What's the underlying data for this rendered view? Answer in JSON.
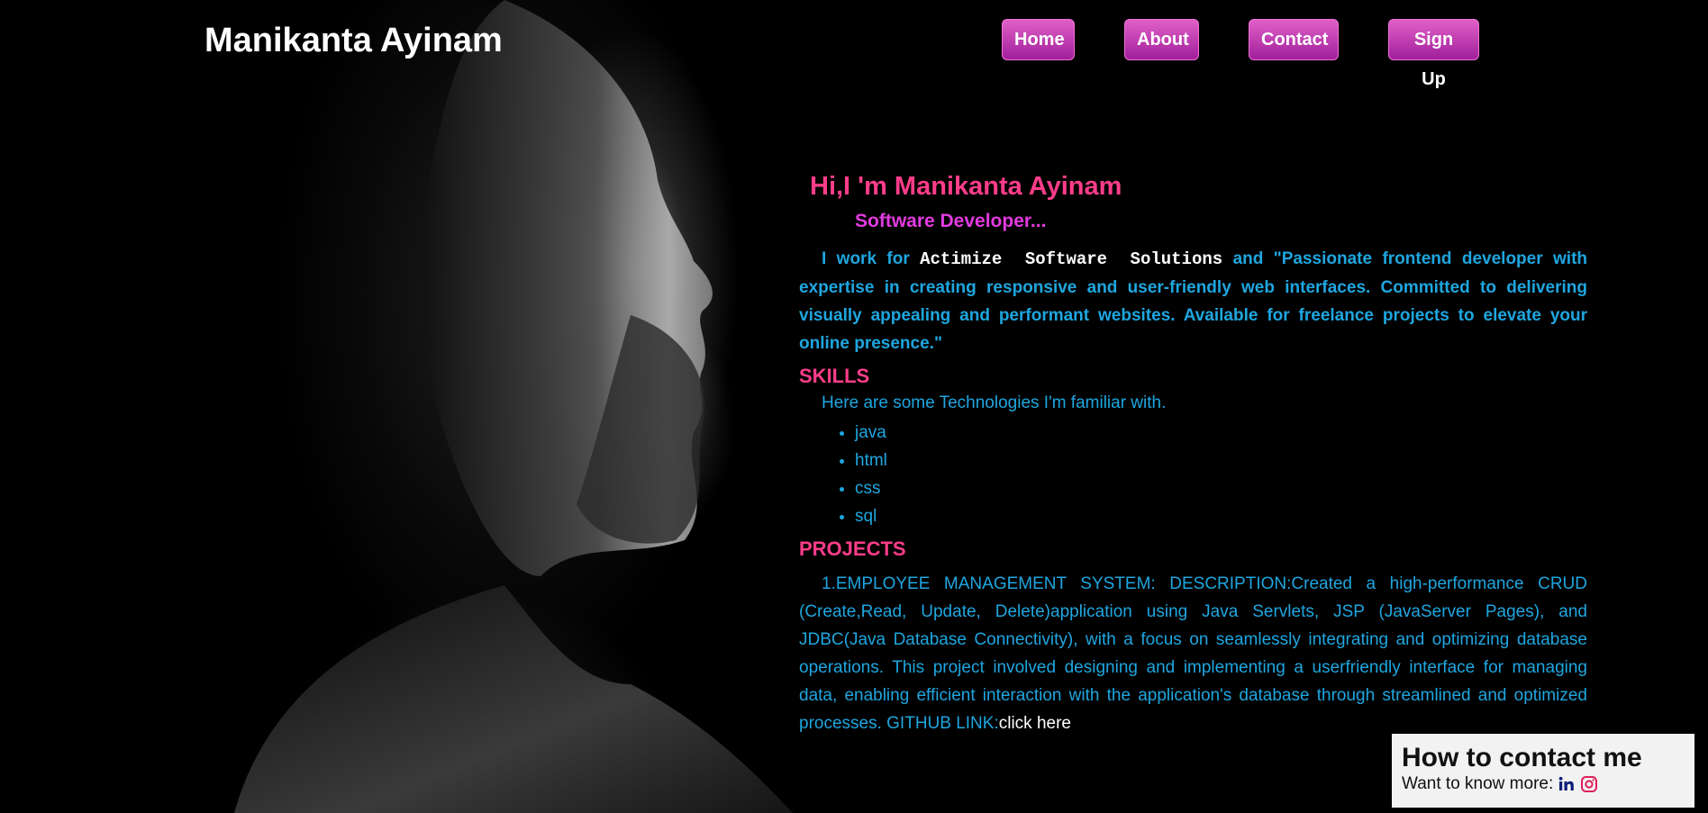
{
  "header": {
    "brand": "Manikanta Ayinam",
    "nav": [
      {
        "label": "Home"
      },
      {
        "label": "About"
      },
      {
        "label": "Contact"
      },
      {
        "label": "Sign Up"
      }
    ]
  },
  "colors": {
    "accent_pink": "#ff3d8a",
    "accent_magenta": "#e23be0",
    "text_blue": "#1fa6df",
    "button_gradient": [
      "#e060c8",
      "#a11f9a"
    ]
  },
  "intro": {
    "greeting": "Hi,I 'm Manikanta Ayinam",
    "role": "Software Developer...",
    "about_prefix": "I work for",
    "company": "Actimize Software Solutions",
    "about_suffix": "and \"Passionate frontend developer with expertise in creating responsive and user-friendly web interfaces. Committed to delivering visually appealing and performant websites. Available for freelance projects to elevate your online presence.\""
  },
  "skills": {
    "title": "SKILLS",
    "intro": "Here are some Technologies I'm familiar with.",
    "items": [
      "java",
      "html",
      "css",
      "sql"
    ]
  },
  "projects": {
    "title": "PROJECTS",
    "item1_text": "1.EMPLOYEE MANAGEMENT SYSTEM: DESCRIPTION:Created a high-performance CRUD (Create,Read, Update, Delete)application using Java Servlets, JSP (JavaServer Pages), and JDBC(Java Database Connectivity), with a focus on seamlessly integrating and optimizing database operations. This project involved designing and implementing a userfriendly interface for managing data, enabling efficient interaction with the application's database through streamlined and optimized processes. GITHUB LINK:",
    "item1_link": "click here"
  },
  "contact": {
    "title": "How to contact me",
    "prompt": "Want to know more:",
    "icons": [
      "linkedin-icon",
      "instagram-icon"
    ]
  }
}
